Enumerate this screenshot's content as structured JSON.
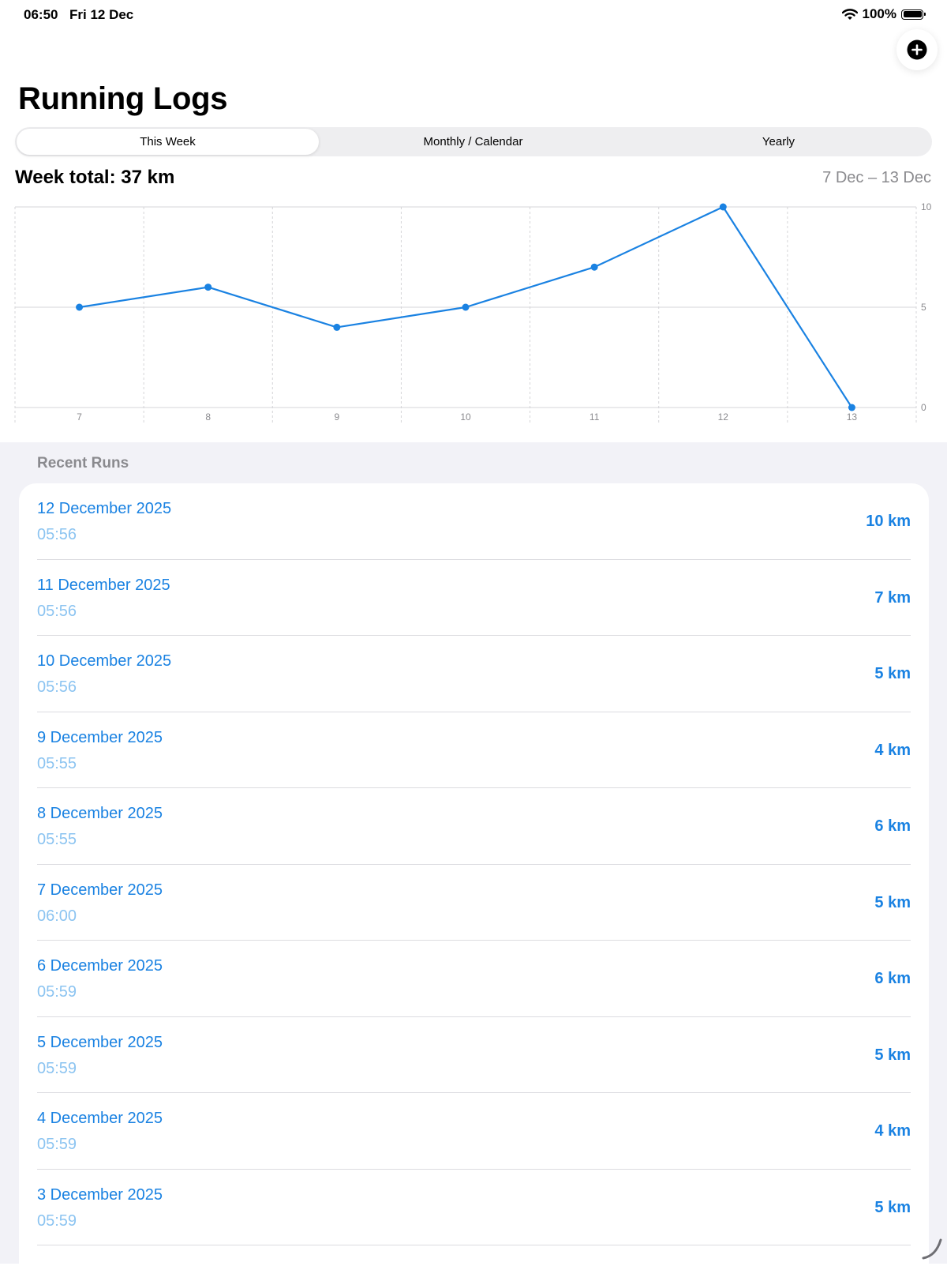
{
  "status": {
    "time": "06:50",
    "date": "Fri 12 Dec",
    "battery": "100%"
  },
  "header": {
    "title": "Running Logs",
    "add_icon": "plus-circle-icon"
  },
  "tabs": [
    {
      "label": "This Week",
      "selected": true
    },
    {
      "label": "Monthly / Calendar",
      "selected": false
    },
    {
      "label": "Yearly",
      "selected": false
    }
  ],
  "summary": {
    "total": "Week total: 37 km",
    "range": "7 Dec – 13 Dec"
  },
  "chart_data": {
    "type": "line",
    "x": [
      7,
      8,
      9,
      10,
      11,
      12,
      13
    ],
    "series": [
      {
        "values": [
          5,
          6,
          4,
          5,
          7,
          10,
          0
        ]
      }
    ],
    "ylim": [
      0,
      10
    ],
    "yticks": [
      0,
      5,
      10
    ],
    "xtick_labels": [
      "7",
      "8",
      "9",
      "10",
      "11",
      "12",
      "13"
    ],
    "grid": true,
    "color": "#1a82e2"
  },
  "recent": {
    "header": "Recent Runs",
    "items": [
      {
        "date": "12 December 2025",
        "time": "05:56",
        "distance": "10 km"
      },
      {
        "date": "11 December 2025",
        "time": "05:56",
        "distance": "7 km"
      },
      {
        "date": "10 December 2025",
        "time": "05:56",
        "distance": "5 km"
      },
      {
        "date": "9 December 2025",
        "time": "05:55",
        "distance": "4 km"
      },
      {
        "date": "8 December 2025",
        "time": "05:55",
        "distance": "6 km"
      },
      {
        "date": "7 December 2025",
        "time": "06:00",
        "distance": "5 km"
      },
      {
        "date": "6 December 2025",
        "time": "05:59",
        "distance": "6 km"
      },
      {
        "date": "5 December 2025",
        "time": "05:59",
        "distance": "5 km"
      },
      {
        "date": "4 December 2025",
        "time": "05:59",
        "distance": "4 km"
      },
      {
        "date": "3 December 2025",
        "time": "05:59",
        "distance": "5 km"
      }
    ]
  }
}
